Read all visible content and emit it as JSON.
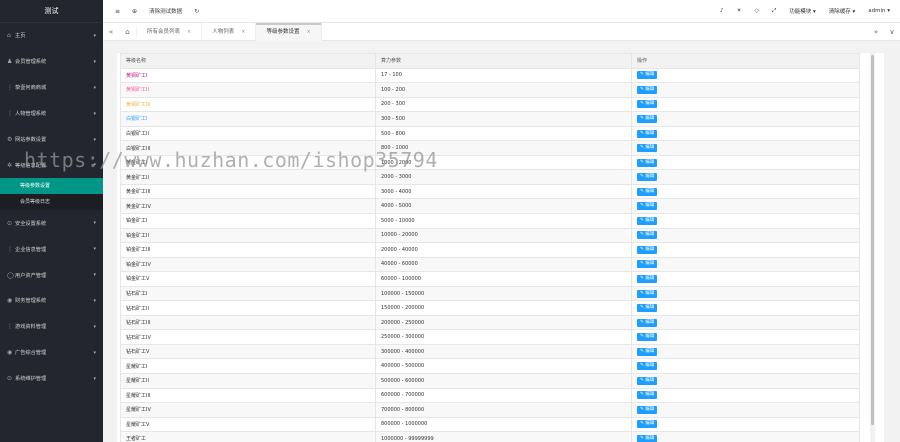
{
  "sidebar": {
    "brand": "测试",
    "items": [
      {
        "label": "主页",
        "icon": "home-icon",
        "glyph": "⌂",
        "caret": true
      },
      {
        "label": "会员管理系统",
        "icon": "user-icon",
        "glyph": "♟",
        "caret": true
      },
      {
        "label": "挚壹何商商城",
        "icon": "shop-icon",
        "glyph": "⋮",
        "caret": true
      },
      {
        "label": "人物管理系统",
        "icon": "person-icon",
        "glyph": "⋮",
        "caret": true
      },
      {
        "label": "网站参数设置",
        "icon": "gear-icon",
        "glyph": "⚙",
        "caret": true
      },
      {
        "label": "等级信息配置",
        "icon": "settings-icon",
        "glyph": "✲",
        "caret": true
      }
    ],
    "sub_items": [
      {
        "label": "等级参数设置",
        "active": true
      },
      {
        "label": "会员等级日志",
        "active": false
      }
    ],
    "items_after": [
      {
        "label": "安全设置系统",
        "icon": "lock-icon",
        "glyph": "⊙",
        "caret": true
      },
      {
        "label": "企业信息管理",
        "icon": "building-icon",
        "glyph": "⋮",
        "caret": true
      },
      {
        "label": "用户资产管理",
        "icon": "wallet-icon",
        "glyph": "◯",
        "caret": true
      },
      {
        "label": "财务管理系统",
        "icon": "finance-icon",
        "glyph": "◉",
        "caret": true
      },
      {
        "label": "游戏资料管理",
        "icon": "game-icon",
        "glyph": "⋮",
        "caret": true
      },
      {
        "label": "广告综合管理",
        "icon": "ad-icon",
        "glyph": "◉",
        "caret": true
      },
      {
        "label": "系统维护管理",
        "icon": "system-icon",
        "glyph": "⊙",
        "caret": true
      }
    ]
  },
  "topbar": {
    "menu_icon": "≡",
    "globe_icon": "⊕",
    "clear_data_label": "清除测试数据",
    "refresh_icon": "↻",
    "bell_icon": "♪",
    "theme_icon": "☀",
    "tag_icon": "◇",
    "fullscreen_icon": "⤢",
    "function_menu_label": "功能模块 ▾",
    "clear_cache_label": "清除缓存 ▾",
    "user_label": "admin ▾"
  },
  "tabs": {
    "prev_icon": "«",
    "home_icon": "⌂",
    "items": [
      {
        "label": "所有会员列表",
        "active": false
      },
      {
        "label": "人物列表",
        "active": false
      },
      {
        "label": "等级参数设置",
        "active": true
      }
    ],
    "close_glyph": "×",
    "next_icon": "»",
    "more_icon": "∨"
  },
  "table": {
    "headers": [
      "等级名称",
      "算力参数",
      "操作"
    ],
    "edit_label": "✎ 编辑",
    "rows": [
      {
        "name": "黄铜矿工I",
        "range": "17 - 100",
        "color": "#c71585"
      },
      {
        "name": "黄铜矿工II",
        "range": "100 - 200",
        "color": "#ff5a8a"
      },
      {
        "name": "黄铜矿工III",
        "range": "200 - 300",
        "color": "#e8b84a"
      },
      {
        "name": "白银矿工I",
        "range": "300 - 500",
        "color": "#3aa0ff"
      },
      {
        "name": "白银矿工II",
        "range": "500 - 800",
        "color": "#333333"
      },
      {
        "name": "白银矿工III",
        "range": "800 - 1000",
        "color": "#333333"
      },
      {
        "name": "黄金矿工I",
        "range": "1000 - 2000",
        "color": "#333333"
      },
      {
        "name": "黄金矿工II",
        "range": "2000 - 3000",
        "color": "#333333"
      },
      {
        "name": "黄金矿工III",
        "range": "3000 - 4000",
        "color": "#333333"
      },
      {
        "name": "黄金矿工IV",
        "range": "4000 - 5000",
        "color": "#333333"
      },
      {
        "name": "铂金矿工I",
        "range": "5000 - 10000",
        "color": "#333333"
      },
      {
        "name": "铂金矿工II",
        "range": "10000 - 20000",
        "color": "#333333"
      },
      {
        "name": "铂金矿工III",
        "range": "20000 - 40000",
        "color": "#333333"
      },
      {
        "name": "铂金矿工IV",
        "range": "40000 - 60000",
        "color": "#333333"
      },
      {
        "name": "铂金矿工V",
        "range": "60000 - 100000",
        "color": "#333333"
      },
      {
        "name": "钻石矿工I",
        "range": "100000 - 150000",
        "color": "#333333"
      },
      {
        "name": "钻石矿工II",
        "range": "150000 - 200000",
        "color": "#333333"
      },
      {
        "name": "钻石矿工III",
        "range": "200000 - 250000",
        "color": "#333333"
      },
      {
        "name": "钻石矿工IV",
        "range": "250000 - 300000",
        "color": "#333333"
      },
      {
        "name": "钻石矿工V",
        "range": "300000 - 400000",
        "color": "#333333"
      },
      {
        "name": "星耀矿工I",
        "range": "400000 - 500000",
        "color": "#333333"
      },
      {
        "name": "星耀矿工II",
        "range": "500000 - 600000",
        "color": "#333333"
      },
      {
        "name": "星耀矿工III",
        "range": "600000 - 700000",
        "color": "#333333"
      },
      {
        "name": "星耀矿工IV",
        "range": "700000 - 800000",
        "color": "#333333"
      },
      {
        "name": "星耀矿工V",
        "range": "800000 - 1000000",
        "color": "#333333"
      },
      {
        "name": "王者矿工",
        "range": "1000000 - 99999999",
        "color": "#333333"
      }
    ]
  },
  "watermark": "https://www.huzhan.com/ishop35794"
}
